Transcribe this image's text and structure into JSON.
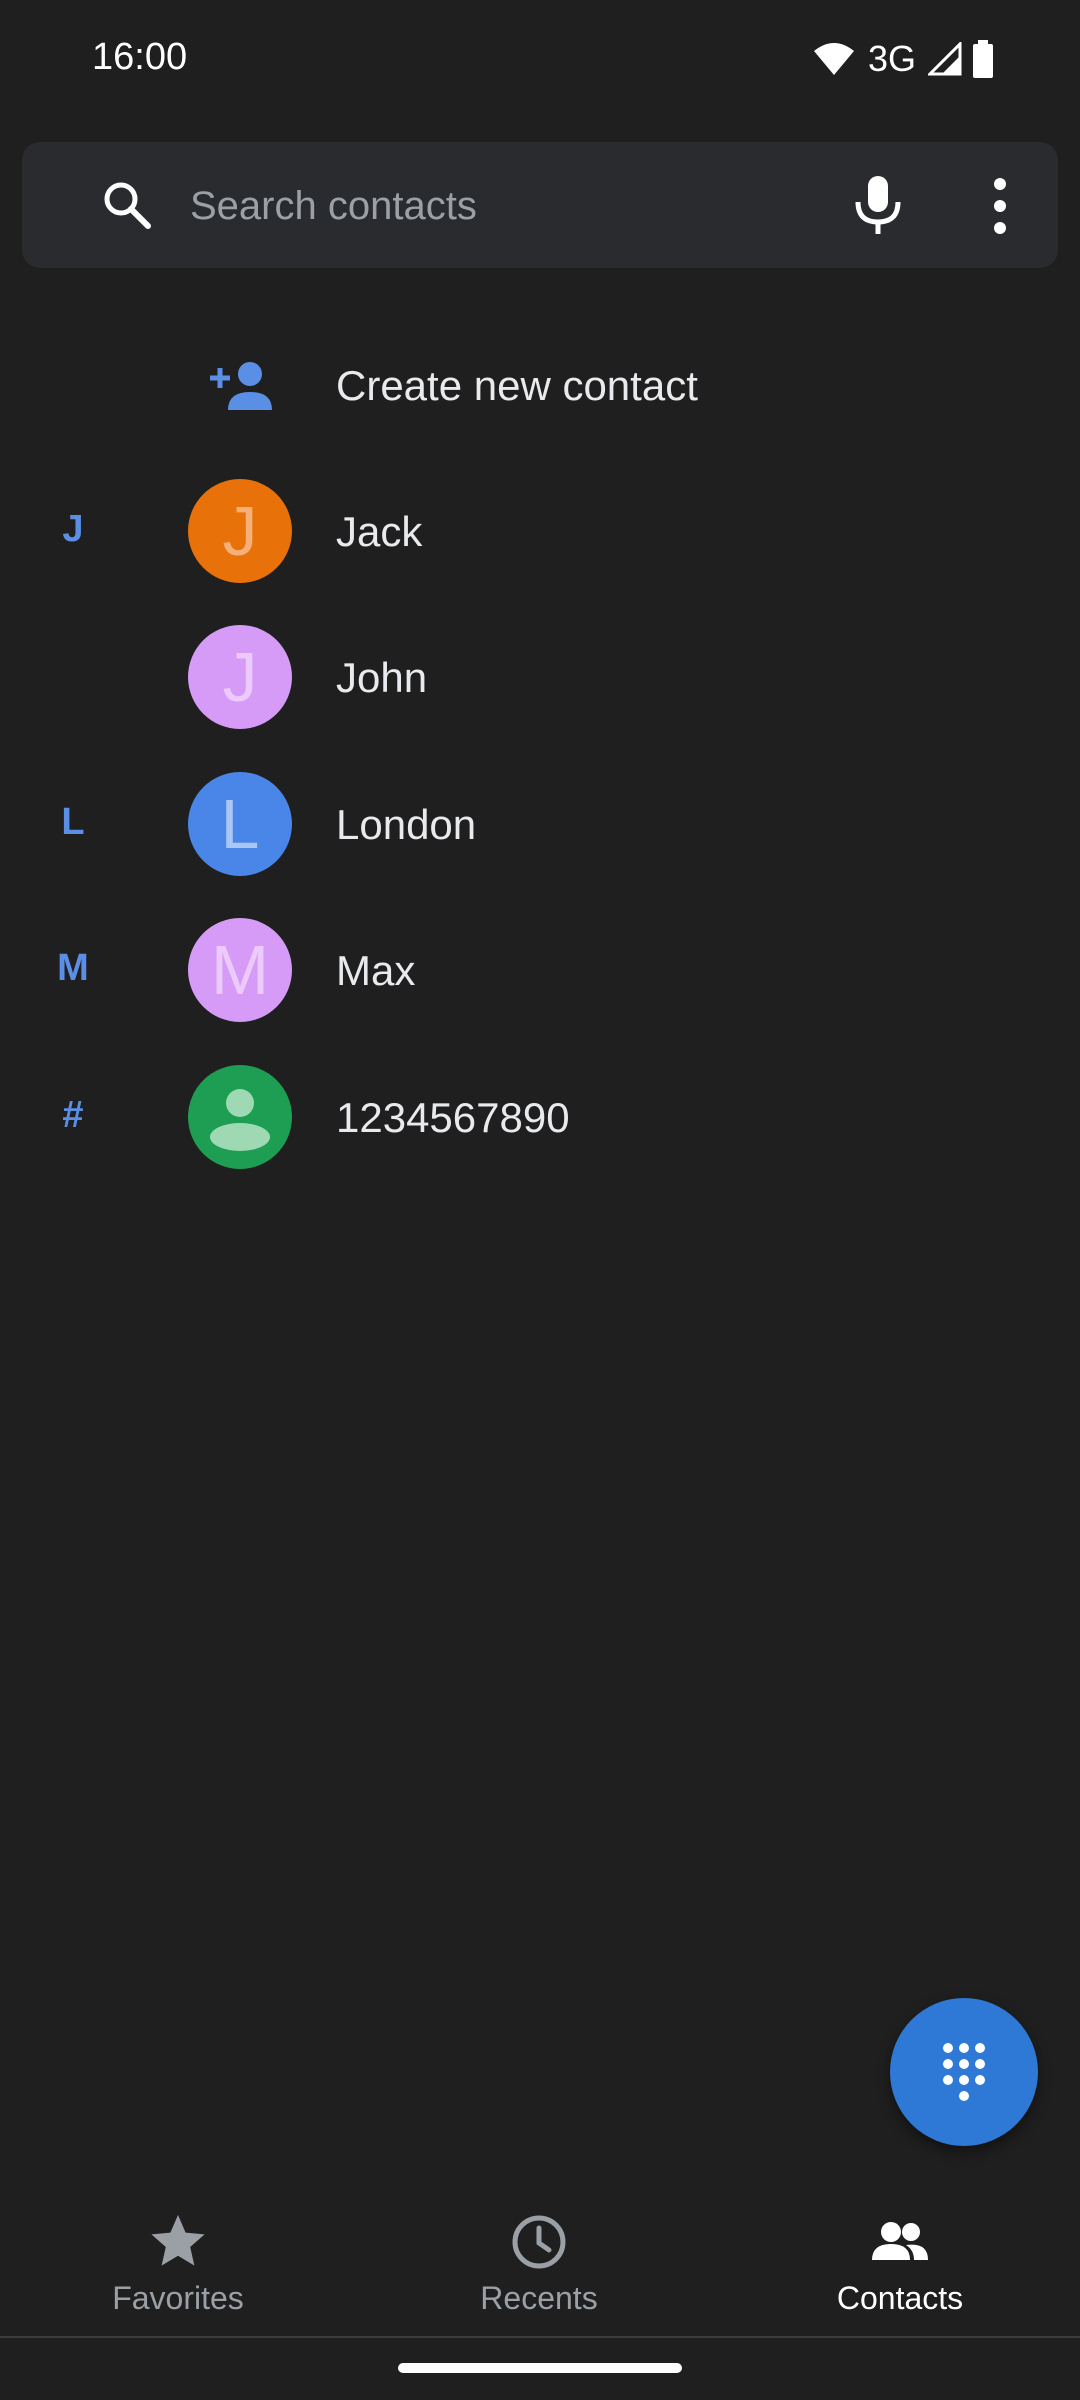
{
  "status_bar": {
    "time": "16:00",
    "network_label": "3G"
  },
  "search": {
    "placeholder": "Search contacts",
    "value": ""
  },
  "create_contact": {
    "label": "Create new contact",
    "accent_color": "#5b8fe6"
  },
  "contacts": [
    {
      "section": "J",
      "initial": "J",
      "name": "Jack",
      "avatar_color": "#e8710a",
      "initial_color": "#f5b07a"
    },
    {
      "section": "",
      "initial": "J",
      "name": "John",
      "avatar_color": "#d59bf6",
      "initial_color": "#eccafb"
    },
    {
      "section": "L",
      "initial": "L",
      "name": "London",
      "avatar_color": "#4a86e8",
      "initial_color": "#a9c6f5"
    },
    {
      "section": "M",
      "initial": "M",
      "name": "Max",
      "avatar_color": "#d59bf6",
      "initial_color": "#eccafb"
    },
    {
      "section": "#",
      "initial": "",
      "name": "1234567890",
      "avatar_color": "#1e9e52",
      "avatar_icon": "person-icon"
    }
  ],
  "bottom_nav": {
    "items": [
      {
        "label": "Favorites",
        "icon": "star-icon",
        "active": false
      },
      {
        "label": "Recents",
        "icon": "clock-icon",
        "active": false
      },
      {
        "label": "Contacts",
        "icon": "people-icon",
        "active": true
      }
    ]
  },
  "colors": {
    "background": "#1f1f1f",
    "search_bg": "#2a2b2f",
    "section_letter": "#5b8fe6",
    "fab": "#2e78d6"
  }
}
